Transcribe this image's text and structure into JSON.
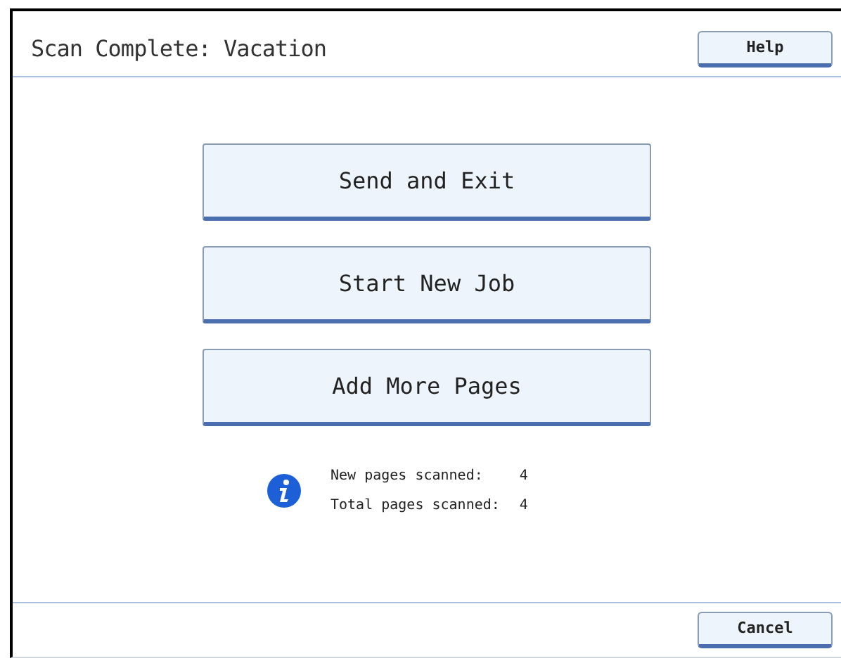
{
  "header": {
    "title": "Scan Complete: Vacation",
    "help_button": "Help"
  },
  "actions": [
    "Send and Exit",
    "Start New Job",
    "Add More Pages"
  ],
  "info": [
    {
      "label": "New pages scanned:",
      "value": "4"
    },
    {
      "label": "Total pages scanned:",
      "value": "4"
    }
  ],
  "footer": {
    "cancel_button": "Cancel"
  }
}
